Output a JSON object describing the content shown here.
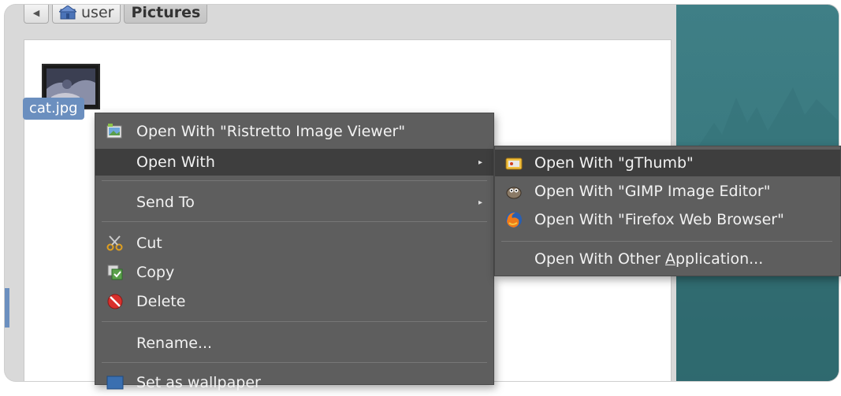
{
  "pathbar": {
    "back_glyph": "◀",
    "user_label": "user",
    "current_label": "Pictures"
  },
  "file": {
    "name": "cat.jpg"
  },
  "context_menu": {
    "items": [
      {
        "label": "Open With \"Ristretto Image Viewer\"",
        "icon": "image-viewer-icon"
      },
      {
        "label": "Open With",
        "icon": "",
        "submenu": true
      },
      {
        "label": "Send To",
        "icon": "",
        "submenu": true
      },
      {
        "label": "Cut",
        "icon": "scissors-icon"
      },
      {
        "label": "Copy",
        "icon": "copy-icon"
      },
      {
        "label": "Delete",
        "icon": "delete-icon"
      },
      {
        "label": "Rename...",
        "icon": ""
      },
      {
        "label": "Set as wallpaper",
        "icon": "wallpaper-icon"
      }
    ],
    "submenu_arrow": "▸"
  },
  "submenu": {
    "items": [
      {
        "label": "Open With \"gThumb\"",
        "icon": "gthumb-icon"
      },
      {
        "label": "Open With \"GIMP Image Editor\"",
        "icon": "gimp-icon"
      },
      {
        "label": "Open With \"Firefox Web Browser\"",
        "icon": "firefox-icon"
      },
      {
        "label_prefix": "Open With Other ",
        "label_underlined": "A",
        "label_suffix": "pplication..."
      }
    ]
  },
  "colors": {
    "menu_bg": "#5e5e5e",
    "menu_highlight": "#3e3e3e",
    "selection": "#6b8fbf",
    "wallpaper": "#3f7f86"
  }
}
